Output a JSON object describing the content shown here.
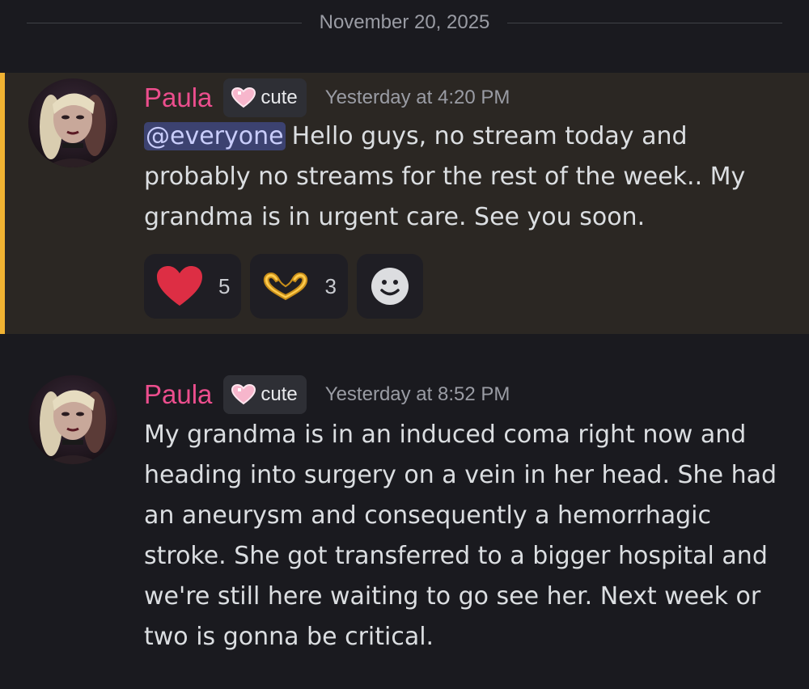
{
  "date_divider": "November 20, 2025",
  "messages": [
    {
      "author": "Paula",
      "tag": {
        "icon": "heart-icon",
        "label": "cute"
      },
      "timestamp": "Yesterday at 4:20 PM",
      "mention": "@everyone",
      "text": "Hello guys, no stream today and probably no streams for the rest of the week.. My grandma is in urgent care. See you soon.",
      "highlighted": true,
      "reactions": [
        {
          "icon": "red-heart-icon",
          "count": "5"
        },
        {
          "icon": "heart-hands-icon",
          "count": "3"
        }
      ],
      "add_reaction_icon": "add-reaction-smiley-icon"
    },
    {
      "author": "Paula",
      "tag": {
        "icon": "heart-icon",
        "label": "cute"
      },
      "timestamp": "Yesterday at 8:52 PM",
      "text": "My grandma is in an induced coma right now and heading into surgery on a vein in her head. She had an aneurysm and consequently a hemorrhagic stroke. She got transferred to a bigger hospital and we're still here waiting to go see her. Next week or two is gonna be critical.",
      "highlighted": false
    }
  ],
  "colors": {
    "background": "#1a1a1f",
    "highlight_background": "#2b2723",
    "highlight_bar": "#f0b232",
    "author": "#ec4e8d",
    "mention_bg": "#3c4270",
    "mention_text": "#c9cdfb"
  }
}
